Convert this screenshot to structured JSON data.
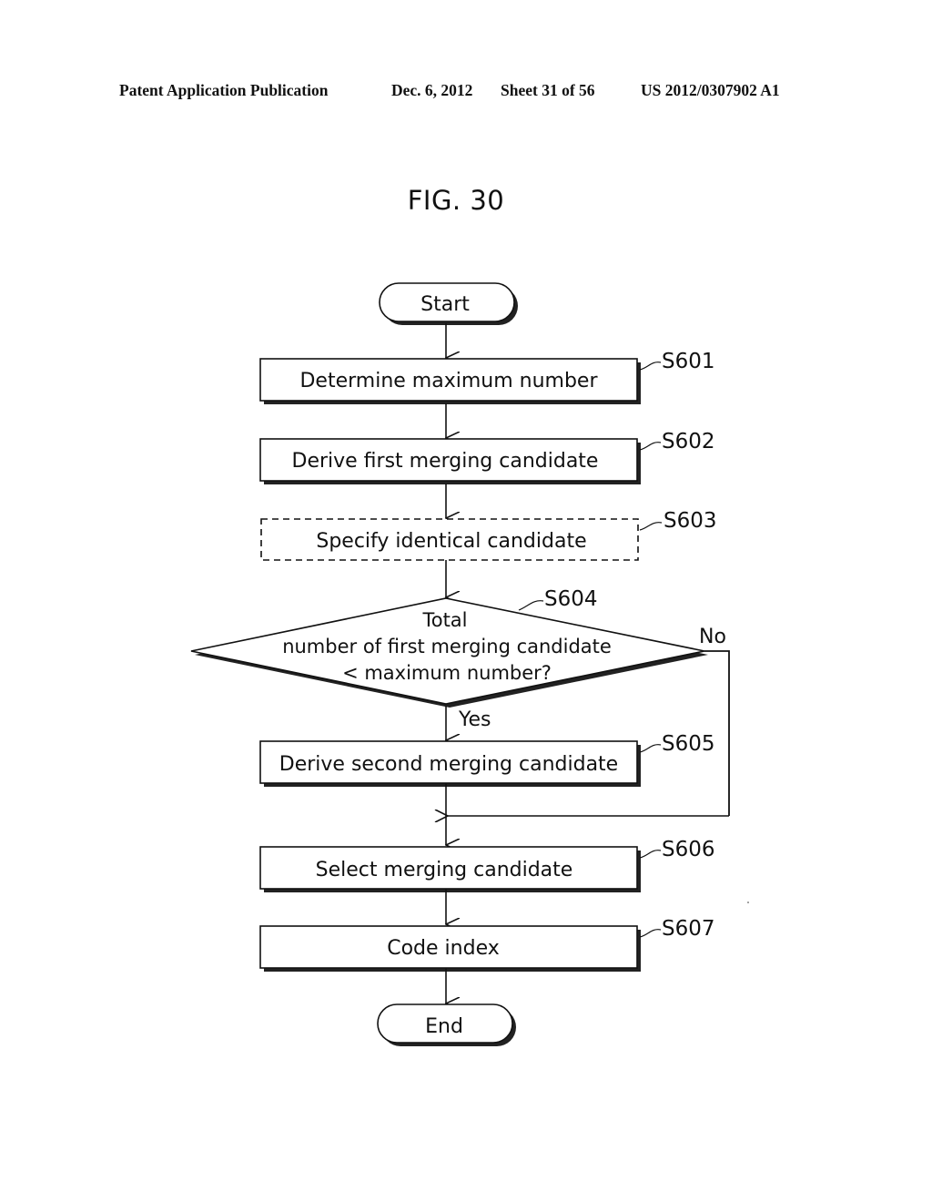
{
  "header": {
    "publication_type": "Patent Application Publication",
    "date": "Dec. 6, 2012",
    "sheet": "Sheet 31 of 56",
    "patent_number": "US 2012/0307902 A1"
  },
  "figure": {
    "title": "FIG. 30"
  },
  "flowchart": {
    "start": "Start",
    "end": "End",
    "steps": [
      {
        "id": "S601",
        "label": "Determine maximum number",
        "style": "solid"
      },
      {
        "id": "S602",
        "label": "Derive first merging candidate",
        "style": "solid"
      },
      {
        "id": "S603",
        "label": "Specify identical candidate",
        "style": "dashed"
      },
      {
        "id": "S605",
        "label": "Derive second merging candidate",
        "style": "solid"
      },
      {
        "id": "S606",
        "label": "Select merging candidate",
        "style": "solid"
      },
      {
        "id": "S607",
        "label": "Code index",
        "style": "solid"
      }
    ],
    "decision": {
      "id": "S604",
      "lines": [
        "Total",
        "number of first merging candidate",
        "< maximum number?"
      ],
      "yes_label": "Yes",
      "no_label": "No"
    }
  }
}
